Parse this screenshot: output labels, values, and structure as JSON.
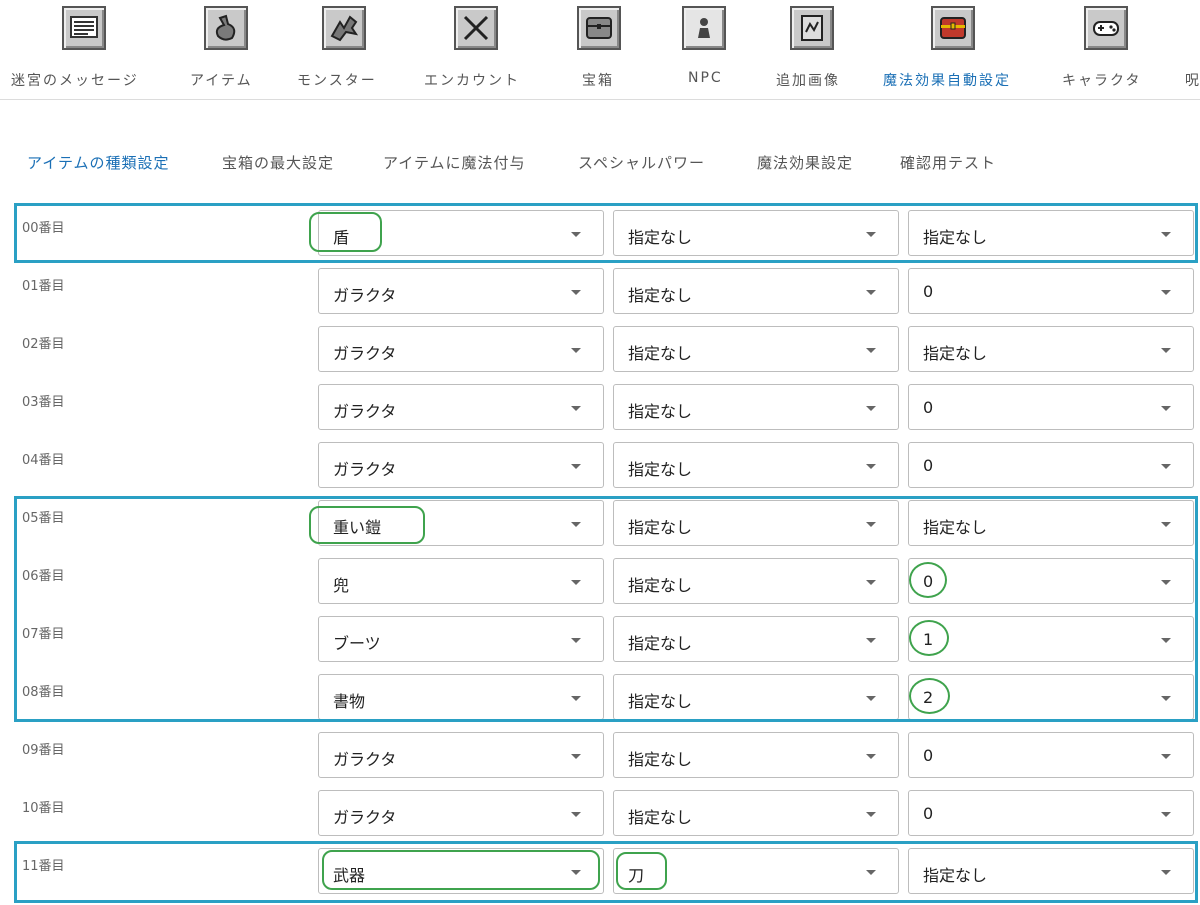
{
  "toolbar": {
    "items": [
      {
        "label": "迷宮のメッセージ",
        "icon": "message-board-icon"
      },
      {
        "label": "アイテム",
        "icon": "item-bag-icon"
      },
      {
        "label": "モンスター",
        "icon": "monster-dragon-icon"
      },
      {
        "label": "エンカウント",
        "icon": "crossed-swords-icon"
      },
      {
        "label": "宝箱",
        "icon": "treasure-chest-icon"
      },
      {
        "label": "NPC",
        "icon": "npc-figure-icon"
      },
      {
        "label": "追加画像",
        "icon": "image-scroll-icon"
      },
      {
        "label": "魔法効果自動設定",
        "icon": "magic-chest-icon"
      },
      {
        "label": "キャラクタ",
        "icon": "gamepad-icon"
      },
      {
        "label": "呪",
        "icon": "curse-icon"
      }
    ],
    "active_index": 7,
    "active_color": "#1a6fb5"
  },
  "tabs": {
    "items": [
      "アイテムの種類設定",
      "宝箱の最大設定",
      "アイテムに魔法付与",
      "スペシャルパワー",
      "魔法効果設定",
      "確認用テスト"
    ],
    "active_index": 0
  },
  "rows": [
    {
      "label": "00番目",
      "type": "盾",
      "sub": "指定なし",
      "value": "指定なし"
    },
    {
      "label": "01番目",
      "type": "ガラクタ",
      "sub": "指定なし",
      "value": "0"
    },
    {
      "label": "02番目",
      "type": "ガラクタ",
      "sub": "指定なし",
      "value": "指定なし"
    },
    {
      "label": "03番目",
      "type": "ガラクタ",
      "sub": "指定なし",
      "value": "0"
    },
    {
      "label": "04番目",
      "type": "ガラクタ",
      "sub": "指定なし",
      "value": "0"
    },
    {
      "label": "05番目",
      "type": "重い鎧",
      "sub": "指定なし",
      "value": "指定なし"
    },
    {
      "label": "06番目",
      "type": "兜",
      "sub": "指定なし",
      "value": "0"
    },
    {
      "label": "07番目",
      "type": "ブーツ",
      "sub": "指定なし",
      "value": "1"
    },
    {
      "label": "08番目",
      "type": "書物",
      "sub": "指定なし",
      "value": "2"
    },
    {
      "label": "09番目",
      "type": "ガラクタ",
      "sub": "指定なし",
      "value": "0"
    },
    {
      "label": "10番目",
      "type": "ガラクタ",
      "sub": "指定なし",
      "value": "0"
    },
    {
      "label": "11番目",
      "type": "武器",
      "sub": "刀",
      "value": "指定なし"
    }
  ],
  "annotations": {
    "highlight_color": "#2aa0c4",
    "circle_color": "#3fa34d"
  }
}
